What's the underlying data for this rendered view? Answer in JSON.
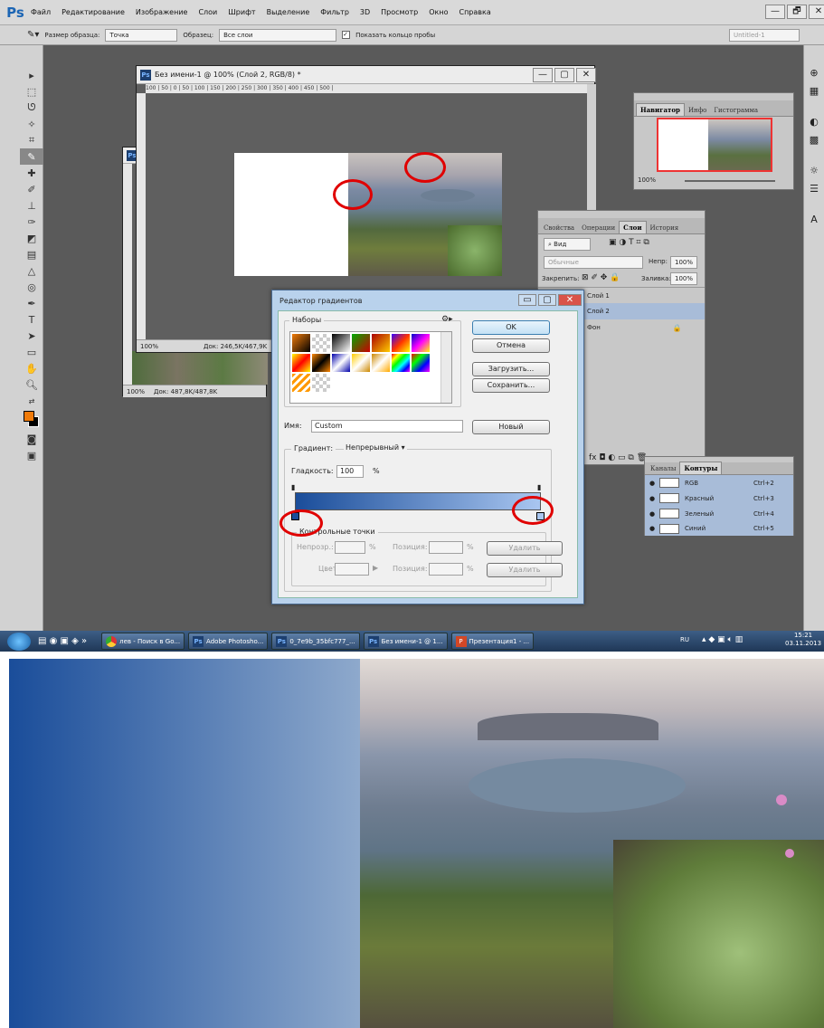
{
  "app": {
    "logo": "Ps",
    "menu": [
      "Файл",
      "Редактирование",
      "Изображение",
      "Слои",
      "Шрифт",
      "Выделение",
      "Фильтр",
      "3D",
      "Просмотр",
      "Окно",
      "Справка"
    ],
    "window_controls": [
      "—",
      "🗗",
      "✕"
    ],
    "doc_preset": "Untitled-1"
  },
  "options": {
    "sample_size_label": "Размер образца:",
    "sample_size_value": "Точка",
    "sample_label": "Образец:",
    "sample_value": "Все слои",
    "ring_label": "Показать кольцо пробы"
  },
  "doc_main": {
    "title": "Без имени-1 @ 100% (Слой 2, RGB/8) *",
    "ruler_h": "  100   |   50   |   0   |   50   |  100  |  150  |  200  |  250  |  300  |  350  |  400  |  450  |  500  |",
    "zoom": "100%",
    "doc_info": "Док: 246,5K/467,9K"
  },
  "doc_back": {
    "zoom": "100%",
    "doc_info": "Док: 487,8K/487,8K",
    "icon": "Ps"
  },
  "navigator": {
    "tabs": [
      "Навигатор",
      "Инфо",
      "Гистограмма"
    ],
    "zoom": "100%"
  },
  "layers": {
    "tabs": [
      "Свойства",
      "Операции",
      "Слои",
      "История"
    ],
    "filter_label": "Вид",
    "blend": "Обычные",
    "opacity_label": "Непр:",
    "opacity": "100%",
    "lock_label": "Закрепить:",
    "fill_label": "Заливка:",
    "fill": "100%",
    "items": [
      "Слой 1",
      "Слой 2",
      "Фон"
    ],
    "footer": "fx  ◘  ◐  ▭  ⧉  🗑"
  },
  "channels": {
    "tabs": [
      "Каналы",
      "Контуры"
    ],
    "items": [
      {
        "name": "RGB",
        "key": "Ctrl+2"
      },
      {
        "name": "Красный",
        "key": "Ctrl+3"
      },
      {
        "name": "Зеленый",
        "key": "Ctrl+4"
      },
      {
        "name": "Синий",
        "key": "Ctrl+5"
      }
    ]
  },
  "gradient_editor": {
    "title": "Редактор градиентов",
    "presets_label": "Наборы",
    "ok": "OK",
    "cancel": "Отмена",
    "load": "Загрузить...",
    "save": "Сохранить...",
    "name_label": "Имя:",
    "name_value": "Custom",
    "new": "Новый",
    "type_label": "Градиент:",
    "type_value": "Непрерывный",
    "smooth_label": "Гладкость:",
    "smooth_value": "100",
    "smooth_unit": "%",
    "stops_label": "Контрольные точки",
    "opacity_label": "Непрозр.:",
    "pos_label": "Позиция:",
    "pct": "%",
    "color_label": "Цвет:",
    "delete": "Удалить",
    "colors": {
      "start": "#1a4d9a",
      "end": "#a9c6f0"
    }
  },
  "taskbar": {
    "items": [
      "лев - Поиск в Go...",
      "Adobe Photosho...",
      "0_7e9b_35bfc777_...",
      "Без имени-1 @ 1...",
      "Презентация1 - ..."
    ],
    "lang": "RU",
    "time": "15:21",
    "date": "03.11.2013"
  },
  "bottom": {
    "gradient_start": "#1a4d9a",
    "gradient_end": "#8ea9cc"
  }
}
